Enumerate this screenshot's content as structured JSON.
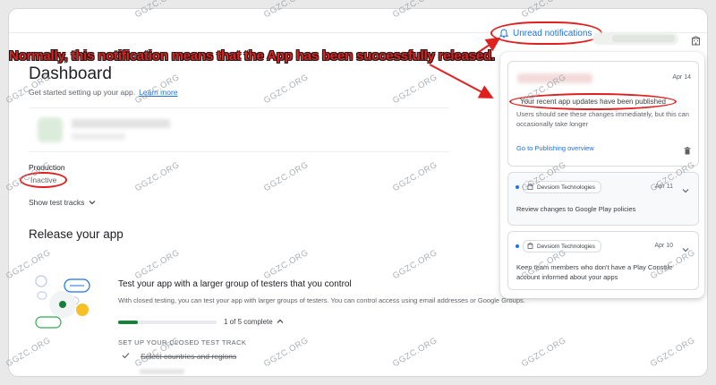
{
  "header": {
    "unread_label": "Unread notifications"
  },
  "annotation": {
    "text": "Normally, this notification means that the App has been successfully released."
  },
  "dashboard": {
    "title": "Dashboard",
    "subtitle": "Get started setting up your app.",
    "learn_more": "Learn more",
    "production_label": "Production",
    "production_status": "Inactive",
    "show_test_tracks": "Show test tracks"
  },
  "release": {
    "title": "Release your app",
    "test_title": "Test your app with a larger group of testers that you control",
    "test_desc": "With closed testing, you can test your app with larger groups of testers. You can control access using email addresses or Google Groups.",
    "progress_text": "1 of 5 complete",
    "progress_fraction": 0.2,
    "setup_heading": "SET UP YOUR CLOSED TEST TRACK",
    "task1": "Select countries and regions"
  },
  "notifications": [
    {
      "date": "Apr 14",
      "headline": "Your recent app updates have been published",
      "body": "Users should see these changes immediately, but this can occasionally take longer",
      "link": "Go to Publishing overview"
    },
    {
      "sender": "Devsiom Technologies",
      "date": "Apr 11",
      "message": "Review changes to Google Play policies"
    },
    {
      "sender": "Devsiom Technologies",
      "date": "Apr 10",
      "message": "Keep team members who don't have a Play Console account informed about your apps"
    }
  ],
  "watermark": "GGZC.ORG",
  "colors": {
    "accent": "#1a73e8",
    "annotation_red": "#e0201f",
    "progress_green": "#188038"
  }
}
